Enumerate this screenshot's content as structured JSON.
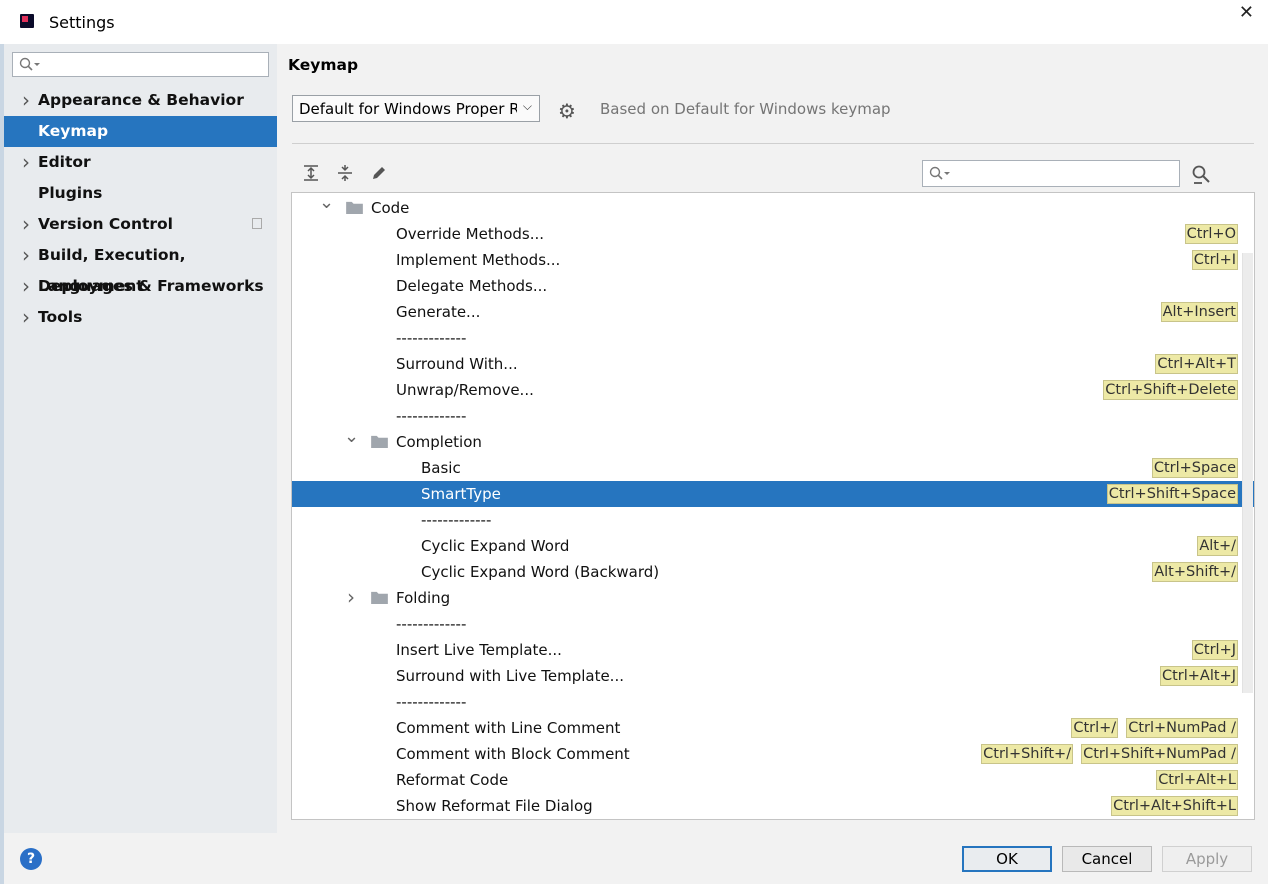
{
  "window": {
    "title": "Settings"
  },
  "sidebar": {
    "search_placeholder": "",
    "items": [
      {
        "label": "Appearance & Behavior",
        "expandable": true
      },
      {
        "label": "Keymap",
        "expandable": false,
        "selected": true
      },
      {
        "label": "Editor",
        "expandable": true
      },
      {
        "label": "Plugins",
        "expandable": false
      },
      {
        "label": "Version Control",
        "expandable": true
      },
      {
        "label": "Build, Execution, Deployment",
        "expandable": true
      },
      {
        "label": "Languages & Frameworks",
        "expandable": true
      },
      {
        "label": "Tools",
        "expandable": true
      }
    ]
  },
  "main": {
    "title": "Keymap",
    "keymap_select": "Default for Windows Proper Re",
    "based_on": "Based on Default for Windows keymap",
    "toolbar": {
      "expand_all": "expand-all-icon",
      "collapse_all": "collapse-all-icon",
      "edit": "pencil-icon"
    },
    "tree_search_placeholder": ""
  },
  "tree": [
    {
      "label": "Code",
      "level": 0,
      "type": "folder",
      "expanded": true,
      "shortcuts": []
    },
    {
      "label": "Override Methods...",
      "level": 1,
      "type": "action",
      "shortcuts": [
        "Ctrl+O"
      ]
    },
    {
      "label": "Implement Methods...",
      "level": 1,
      "type": "action",
      "shortcuts": [
        "Ctrl+I"
      ]
    },
    {
      "label": "Delegate Methods...",
      "level": 1,
      "type": "action",
      "shortcuts": []
    },
    {
      "label": "Generate...",
      "level": 1,
      "type": "action",
      "shortcuts": [
        "Alt+Insert"
      ]
    },
    {
      "label": "-------------",
      "level": 1,
      "type": "separator",
      "shortcuts": []
    },
    {
      "label": "Surround With...",
      "level": 1,
      "type": "action",
      "shortcuts": [
        "Ctrl+Alt+T"
      ]
    },
    {
      "label": "Unwrap/Remove...",
      "level": 1,
      "type": "action",
      "shortcuts": [
        "Ctrl+Shift+Delete"
      ]
    },
    {
      "label": "-------------",
      "level": 1,
      "type": "separator",
      "shortcuts": []
    },
    {
      "label": "Completion",
      "level": 1,
      "type": "folder",
      "expanded": true,
      "shortcuts": []
    },
    {
      "label": "Basic",
      "level": 2,
      "type": "action",
      "shortcuts": [
        "Ctrl+Space"
      ]
    },
    {
      "label": "SmartType",
      "level": 2,
      "type": "action",
      "selected": true,
      "shortcuts": [
        "Ctrl+Shift+Space"
      ]
    },
    {
      "label": "-------------",
      "level": 2,
      "type": "separator",
      "shortcuts": []
    },
    {
      "label": "Cyclic Expand Word",
      "level": 2,
      "type": "action",
      "shortcuts": [
        "Alt+/"
      ]
    },
    {
      "label": "Cyclic Expand Word (Backward)",
      "level": 2,
      "type": "action",
      "shortcuts": [
        "Alt+Shift+/"
      ]
    },
    {
      "label": "Folding",
      "level": 1,
      "type": "folder",
      "expanded": false,
      "shortcuts": []
    },
    {
      "label": "-------------",
      "level": 1,
      "type": "separator",
      "shortcuts": []
    },
    {
      "label": "Insert Live Template...",
      "level": 1,
      "type": "action",
      "shortcuts": [
        "Ctrl+J"
      ]
    },
    {
      "label": "Surround with Live Template...",
      "level": 1,
      "type": "action",
      "shortcuts": [
        "Ctrl+Alt+J"
      ]
    },
    {
      "label": "-------------",
      "level": 1,
      "type": "separator",
      "shortcuts": []
    },
    {
      "label": "Comment with Line Comment",
      "level": 1,
      "type": "action",
      "shortcuts": [
        "Ctrl+/",
        "Ctrl+NumPad /"
      ]
    },
    {
      "label": "Comment with Block Comment",
      "level": 1,
      "type": "action",
      "shortcuts": [
        "Ctrl+Shift+/",
        "Ctrl+Shift+NumPad /"
      ]
    },
    {
      "label": "Reformat Code",
      "level": 1,
      "type": "action",
      "shortcuts": [
        "Ctrl+Alt+L"
      ]
    },
    {
      "label": "Show Reformat File Dialog",
      "level": 1,
      "type": "action",
      "shortcuts": [
        "Ctrl+Alt+Shift+L"
      ]
    }
  ],
  "buttons": {
    "help": "?",
    "ok": "OK",
    "cancel": "Cancel",
    "apply": "Apply"
  },
  "colors": {
    "accent": "#2675bf",
    "shortcut_bg": "#ede9a6",
    "sidebar_bg": "#e8ebee"
  }
}
